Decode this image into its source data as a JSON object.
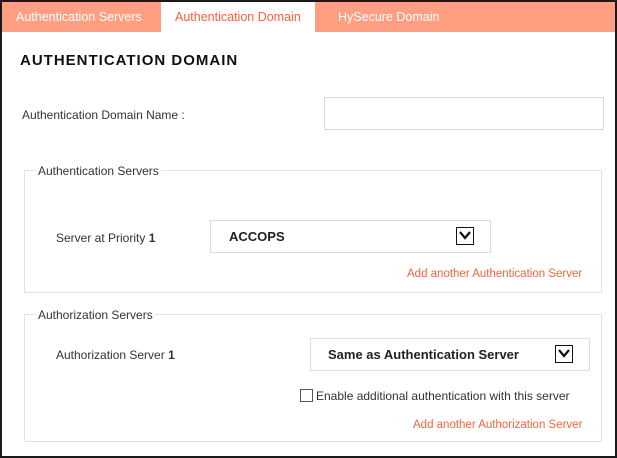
{
  "tabs": [
    {
      "label": "Authentication Servers",
      "active": false
    },
    {
      "label": "Authentication Domain",
      "active": true
    },
    {
      "label": "HySecure Domain",
      "active": false
    }
  ],
  "page_title": "AUTHENTICATION DOMAIN",
  "domain_name": {
    "label": "Authentication Domain Name :",
    "value": ""
  },
  "auth_servers": {
    "legend": "Authentication Servers",
    "priority_label": "Server at Priority",
    "priority_number": "1",
    "selected_server": "ACCOPS",
    "add_link": "Add another Authentication Server"
  },
  "authz_servers": {
    "legend": "Authorization Servers",
    "server_label": "Authorization Server",
    "server_number": "1",
    "selected_server": "Same as Authentication Server",
    "checkbox_label": "Enable additional authentication with this server",
    "checkbox_checked": false,
    "add_link": "Add another Authorization Server"
  },
  "colors": {
    "tab_bar": "#ff9e80",
    "accent": "#f0643c",
    "border": "#1a1a1a"
  },
  "icons": {
    "dropdown": "chevron-down-icon"
  }
}
